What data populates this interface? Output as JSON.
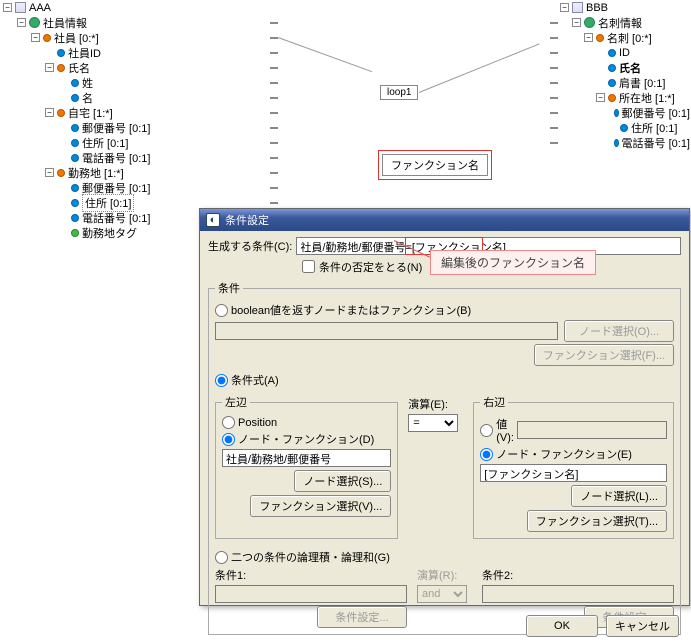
{
  "left_tree": {
    "root_doc": "AAA",
    "root": "社員情報",
    "emp": "社員 [0:*]",
    "empid": "社員ID",
    "name": "氏名",
    "lastname": "姓",
    "firstname": "名",
    "home": "自宅 [1:*]",
    "home_zip": "郵便番号 [0:1]",
    "home_addr": "住所 [0:1]",
    "home_tel": "電話番号 [0:1]",
    "work": "勤務地 [1:*]",
    "work_zip": "郵便番号 [0:1]",
    "work_addr": "住所 [0:1]",
    "work_tel": "電話番号 [0:1]",
    "work_tag": "勤務地タグ"
  },
  "right_tree": {
    "root_doc": "BBB",
    "root": "名刺情報",
    "card": "名刺 [0:*]",
    "id": "ID",
    "name": "氏名",
    "title": "肩書 [0:1]",
    "loc": "所在地 [1:*]",
    "zip": "郵便番号 [0:1]",
    "addr": "住所 [0:1]",
    "tel": "電話番号 [0:1]"
  },
  "diagram": {
    "loop": "loop1",
    "func": "ファンクション名"
  },
  "dialog": {
    "title": "条件設定",
    "gen_label": "生成する条件(C):",
    "gen_value": "社員/勤務地/郵便番号=[ファンクション名]",
    "negate": "条件の否定をとる(N)",
    "group_cond": "条件",
    "bool_radio": "boolean値を返すノードまたはファンクション(B)",
    "node_select": "ノード選択(O)...",
    "func_select": "ファンクション選択(F)...",
    "expr_radio": "条件式(A)",
    "left_grp": "左辺",
    "pos_radio": "Position",
    "nodefunc_radio_l": "ノード・ファンクション(D)",
    "left_val": "社員/勤務地/郵便番号",
    "node_select_s": "ノード選択(S)...",
    "func_select_v": "ファンクション選択(V)...",
    "op_grp": "演算(E):",
    "op_val": "=",
    "right_grp": "右辺",
    "val_radio": "値(V):",
    "nodefunc_radio_r": "ノード・ファンクション(E)",
    "right_val": "[ファンクション名]",
    "node_select_l": "ノード選択(L)...",
    "func_select_t": "ファンクション選択(T)...",
    "logic_radio": "二つの条件の論理積・論理和(G)",
    "cond1": "条件1:",
    "cond2": "条件2:",
    "op2": "演算(R):",
    "and": "and",
    "cond_set": "条件設定...",
    "ok": "OK",
    "cancel": "キャンセル"
  },
  "annotation": "編集後のファンクション名",
  "toggle_minus": "−",
  "toggle_plus": "+"
}
